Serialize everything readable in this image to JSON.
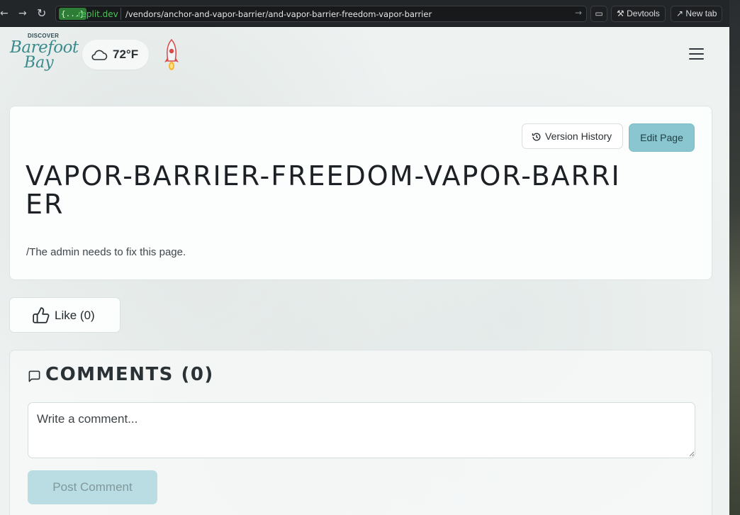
{
  "browser": {
    "back_icon": "arrow-left-icon",
    "forward_icon": "arrow-right-icon",
    "reload_icon": "reload-icon",
    "url_badge": "{...}",
    "url_domain": ".replit.dev",
    "url_path": "/vendors/anchor-and-vapor-barrier/and-vapor-barrier-freedom-vapor-barrier",
    "devtools_label": "Devtools",
    "new_tab_label": "New tab"
  },
  "header": {
    "logo_small": "DISCOVER",
    "logo_line1": "Barefoot",
    "logo_line2": "Bay",
    "weather_icon": "cloud-icon",
    "temperature": "72°F",
    "rocket_icon": "rocket-icon",
    "menu_icon": "hamburger-menu-icon"
  },
  "page": {
    "version_history_label": "Version History",
    "edit_page_label": "Edit Page",
    "title": "VAPOR-BARRIER-FREEDOM-VAPOR-BARRIER",
    "body": "/The admin needs to fix this page."
  },
  "like": {
    "label": "Like (0)"
  },
  "comments": {
    "title": "COMMENTS (0)",
    "placeholder": "Write a comment...",
    "post_label": "Post Comment"
  },
  "colors": {
    "accent": "#8ac6cf",
    "disabled_button": "#b9dde2",
    "logo_teal": "#3b8a8c"
  }
}
